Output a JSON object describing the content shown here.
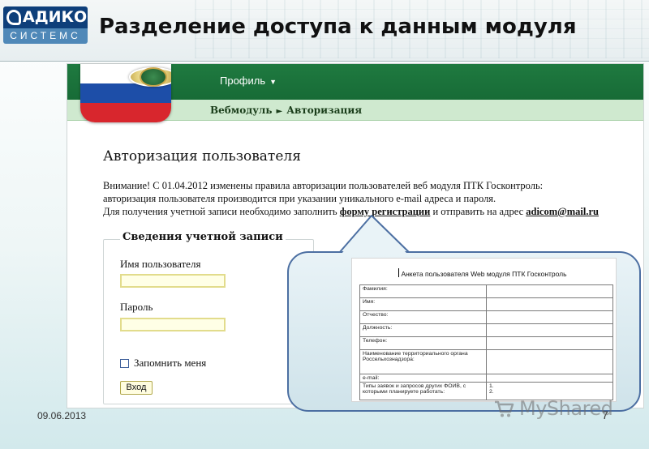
{
  "logo": {
    "top": "АДИКОМ",
    "bottom": "СИСТЕМС"
  },
  "slide": {
    "title": "Разделение доступа к данным модуля"
  },
  "app": {
    "nav": {
      "profile_label": "Профиль",
      "caret": "▼"
    },
    "breadcrumb": {
      "part1": "Вебмодуль",
      "separator": "►",
      "part2": "Авторизация"
    },
    "page_title": "Авторизация пользователя",
    "notice": {
      "line1": "Внимание! С 01.04.2012 изменены правила авторизации пользователей веб модуля ПТК Госконтроль:",
      "line2": "авторизация пользователя производится при указании уникального e-mail адреса и пароля.",
      "line3_prefix": "Для получения учетной записи необходимо заполнить ",
      "registration_link": "форму регистрации",
      "line3_middle": " и отправить на адрес ",
      "email_link": "adicom@mail.ru"
    },
    "login": {
      "legend": "Сведения учетной записи",
      "username_label": "Имя пользователя",
      "username_value": "",
      "password_label": "Пароль",
      "password_value": "",
      "remember_label": "Запомнить меня",
      "remember_checked": false,
      "submit_label": "Вход"
    }
  },
  "form_preview": {
    "title": "Анкета пользователя Web модуля ПТК Госконтроль",
    "rows": [
      {
        "label": "Фамилия:",
        "value": ""
      },
      {
        "label": "Имя:",
        "value": ""
      },
      {
        "label": "Отчество:",
        "value": ""
      },
      {
        "label": "Должность:",
        "value": ""
      },
      {
        "label": "Телефон:",
        "value": ""
      },
      {
        "label": "Наименование территориального органа Россельхознадзора:",
        "value": ""
      },
      {
        "label": "e-mail:",
        "value": ""
      },
      {
        "label": "Типы заявок и запросов других ФОИВ, с которыми планируете работать:",
        "value": "1.\n2."
      }
    ]
  },
  "footer": {
    "date": "09.06.2013",
    "page": "7"
  },
  "watermark": {
    "text": "MyShared"
  },
  "colors": {
    "header_green": "#1f7a40",
    "breadcrumb_green": "#cfe9cf",
    "logo_blue": "#0e3f7a",
    "callout_border": "#4c6fa2"
  }
}
